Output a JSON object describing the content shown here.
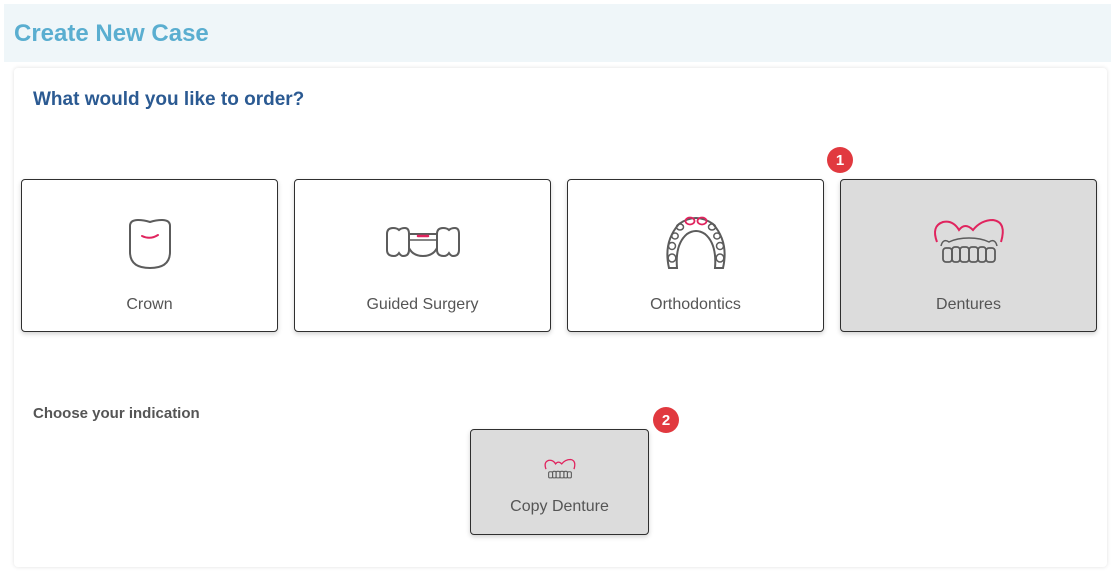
{
  "header": {
    "title": "Create New Case"
  },
  "main": {
    "question": "What would you like to order?",
    "products": [
      {
        "label": "Crown",
        "icon": "crown-icon",
        "selected": false
      },
      {
        "label": "Guided Surgery",
        "icon": "guided-surgery-icon",
        "selected": false
      },
      {
        "label": "Orthodontics",
        "icon": "orthodontics-icon",
        "selected": false
      },
      {
        "label": "Dentures",
        "icon": "dentures-icon",
        "selected": true
      }
    ],
    "indication_label": "Choose your indication",
    "indications": [
      {
        "label": "Copy Denture",
        "icon": "copy-denture-icon",
        "selected": true
      }
    ]
  },
  "badges": {
    "first": "1",
    "second": "2"
  },
  "colors": {
    "accent_pink": "#e0245e",
    "header_title": "#5aaed0",
    "question": "#2b5a92",
    "badge": "#e1393f",
    "selected_bg": "#dcdcdc"
  }
}
